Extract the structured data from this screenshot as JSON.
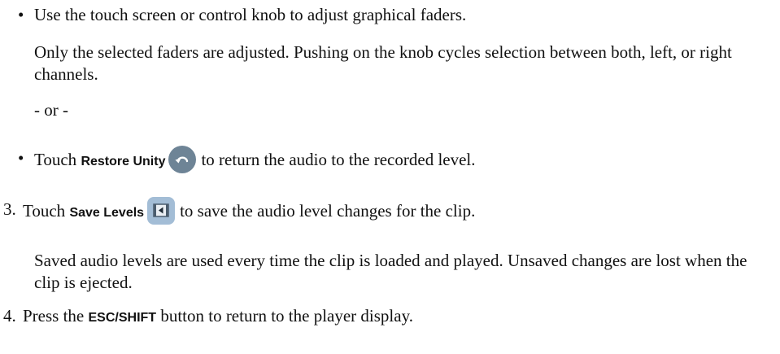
{
  "bullets": {
    "touch_screen": "Use the touch screen or control knob to adjust graphical faders.",
    "touch_screen_detail": "Only the selected faders are adjusted. Pushing on the knob cycles selection between both, left, or right channels.",
    "or_separator": "- or -",
    "restore_prefix": "Touch ",
    "restore_label": "Restore Unity",
    "restore_suffix": "to return the audio to the recorded level.",
    "restore_icon": "undo-icon"
  },
  "steps": {
    "step3_number": "3.",
    "step3_prefix": "Touch ",
    "step3_label": "Save Levels",
    "step3_suffix": "to save the audio level changes for the clip.",
    "step3_icon": "save-levels-icon",
    "step3_detail": "Saved audio levels are used every time the clip is loaded and played. Unsaved changes are lost when the clip is ejected.",
    "step4_number": "4.",
    "step4_prefix": "Press the ",
    "step4_label": "ESC/SHIFT",
    "step4_suffix": " button to return to the player display."
  },
  "bullet_symbol": "•"
}
